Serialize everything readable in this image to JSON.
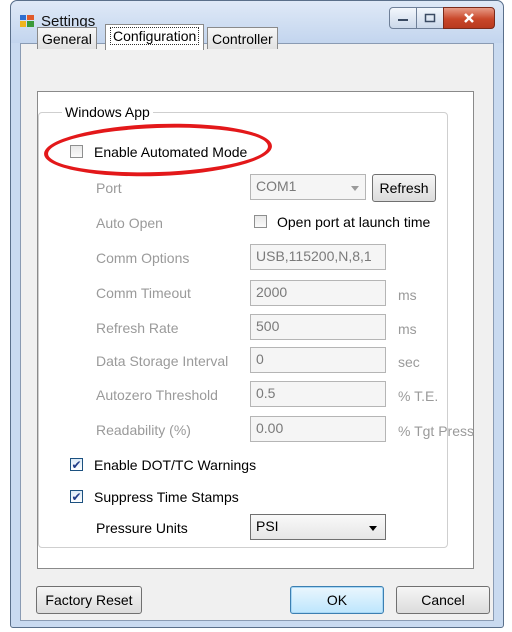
{
  "window": {
    "title": "Settings"
  },
  "tabs": [
    {
      "label": "General"
    },
    {
      "label": "Configuration"
    },
    {
      "label": "Controller"
    }
  ],
  "group": {
    "label": "Windows App"
  },
  "enable_automated_mode": {
    "label": "Enable Automated Mode",
    "checked": false
  },
  "port": {
    "label": "Port",
    "value": "COM1",
    "refresh_label": "Refresh"
  },
  "auto_open": {
    "label": "Auto Open",
    "checkbox_label": "Open port at launch time",
    "checked": false
  },
  "comm_options": {
    "label": "Comm Options",
    "value": "USB,115200,N,8,1"
  },
  "comm_timeout": {
    "label": "Comm Timeout",
    "value": "2000",
    "unit": "ms"
  },
  "refresh_rate": {
    "label": "Refresh Rate",
    "value": "500",
    "unit": "ms"
  },
  "data_storage_interval": {
    "label": "Data Storage Interval",
    "value": "0",
    "unit": "sec"
  },
  "autozero_threshold": {
    "label": "Autozero Threshold",
    "value": "0.5",
    "unit": "% T.E."
  },
  "readability": {
    "label": "Readability (%)",
    "value": "0.00",
    "unit": "% Tgt Press"
  },
  "enable_dot_tc": {
    "label": "Enable DOT/TC Warnings",
    "checked": true
  },
  "suppress_time_stamps": {
    "label": "Suppress Time Stamps",
    "checked": true
  },
  "pressure_units": {
    "label": "Pressure Units",
    "value": "PSI"
  },
  "buttons": {
    "factory_reset": "Factory Reset",
    "ok": "OK",
    "cancel": "Cancel"
  },
  "colors": {
    "annotation": "#e3181a",
    "checkmark": "#1f3c88",
    "close_button": "#c9472a"
  },
  "icons": {
    "app": "settings-app-icon",
    "minimize": "minimize-icon",
    "maximize": "maximize-icon",
    "close": "close-icon"
  }
}
